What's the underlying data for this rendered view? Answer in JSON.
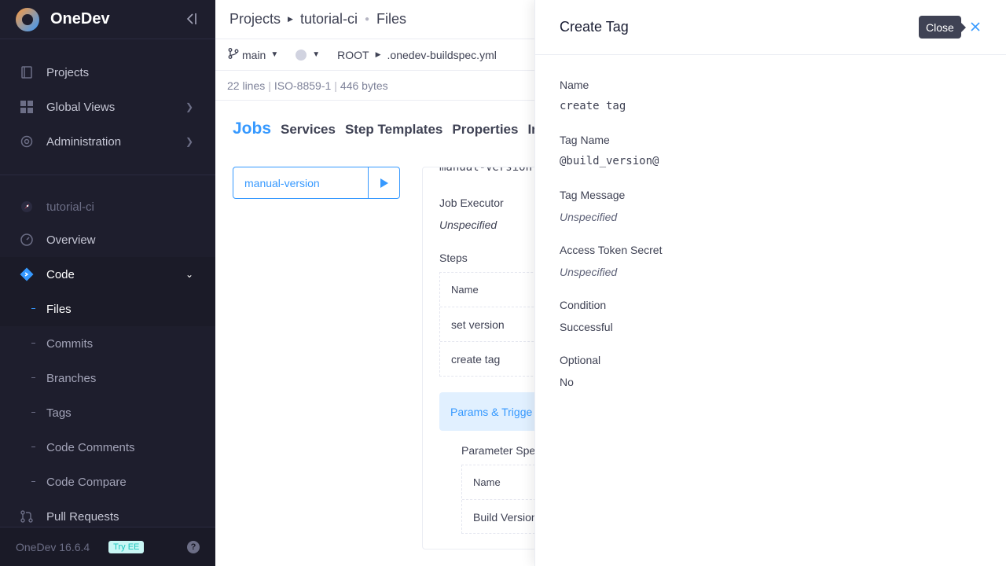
{
  "app": {
    "name": "OneDev",
    "version": "OneDev 16.6.4",
    "try_ee": "Try EE",
    "help": "?"
  },
  "sidebar": {
    "top_items": [
      {
        "label": "Projects",
        "icon": "book-icon"
      },
      {
        "label": "Global Views",
        "icon": "grid-icon"
      },
      {
        "label": "Administration",
        "icon": "gear-icon"
      }
    ],
    "project_name": "tutorial-ci",
    "project_items": [
      {
        "label": "Overview",
        "icon": "gauge-icon"
      },
      {
        "label": "Code",
        "icon": "code-icon"
      }
    ],
    "code_sub_items": [
      "Files",
      "Commits",
      "Branches",
      "Tags",
      "Code Comments",
      "Code Compare"
    ],
    "pull_requests": "Pull Requests"
  },
  "breadcrumb": {
    "projects": "Projects",
    "project": "tutorial-ci",
    "files": "Files"
  },
  "revision": {
    "branch": "main",
    "root": "ROOT",
    "file": ".onedev-buildspec.yml"
  },
  "file_info": {
    "lines": "22 lines",
    "encoding": "ISO-8859-1",
    "size": "446 bytes"
  },
  "tabs": [
    "Jobs",
    "Services",
    "Step Templates",
    "Properties",
    "In"
  ],
  "job": {
    "name": "manual-version",
    "cut_text": "manual-version",
    "executor_label": "Job Executor",
    "executor_value": "Unspecified",
    "steps_label": "Steps",
    "steps_header": "Name",
    "steps": [
      "set version",
      "create tag"
    ],
    "params_tab": "Params & Trigge",
    "param_spec_label": "Parameter Spe",
    "param_header": "Name",
    "param_row": "Build Version"
  },
  "drawer": {
    "title": "Create Tag",
    "close_tooltip": "Close",
    "fields": [
      {
        "label": "Name",
        "value": "create tag",
        "style": "mono"
      },
      {
        "label": "Tag Name",
        "value": "@build_version@",
        "style": "mono"
      },
      {
        "label": "Tag Message",
        "value": "Unspecified",
        "style": "ital"
      },
      {
        "label": "Access Token Secret",
        "value": "Unspecified",
        "style": "ital"
      },
      {
        "label": "Condition",
        "value": "Successful",
        "style": ""
      },
      {
        "label": "Optional",
        "value": "No",
        "style": ""
      }
    ]
  },
  "colors": {
    "accent": "#3699ff",
    "sidebar_bg": "#1e1e2d"
  }
}
